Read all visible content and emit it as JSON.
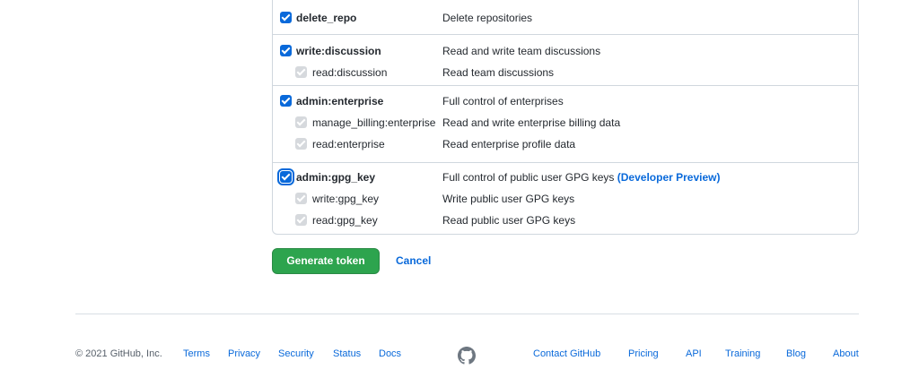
{
  "scopes": {
    "delete_repo": {
      "name": "delete_repo",
      "desc": "Delete repositories"
    },
    "discussion": {
      "parent": {
        "name": "write:discussion",
        "desc": "Read and write team discussions"
      },
      "children": [
        {
          "name": "read:discussion",
          "desc": "Read team discussions"
        }
      ]
    },
    "enterprise": {
      "parent": {
        "name": "admin:enterprise",
        "desc": "Full control of enterprises"
      },
      "children": [
        {
          "name": "manage_billing:enterprise",
          "desc": "Read and write enterprise billing data"
        },
        {
          "name": "read:enterprise",
          "desc": "Read enterprise profile data"
        }
      ]
    },
    "gpg": {
      "parent": {
        "name": "admin:gpg_key",
        "desc": "Full control of public user GPG keys",
        "link": "(Developer Preview)"
      },
      "children": [
        {
          "name": "write:gpg_key",
          "desc": "Write public user GPG keys"
        },
        {
          "name": "read:gpg_key",
          "desc": "Read public user GPG keys"
        }
      ]
    }
  },
  "actions": {
    "generate": "Generate token",
    "cancel": "Cancel"
  },
  "footer": {
    "copyright": "© 2021 GitHub, Inc.",
    "left_links": [
      "Terms",
      "Privacy",
      "Security",
      "Status",
      "Docs"
    ],
    "right_links": [
      "Contact GitHub",
      "Pricing",
      "API",
      "Training",
      "Blog",
      "About"
    ],
    "icon": "github-mark-icon"
  },
  "colors": {
    "accent": "#0969da",
    "primary_button": "#2da44e",
    "border": "#d0d7de"
  }
}
